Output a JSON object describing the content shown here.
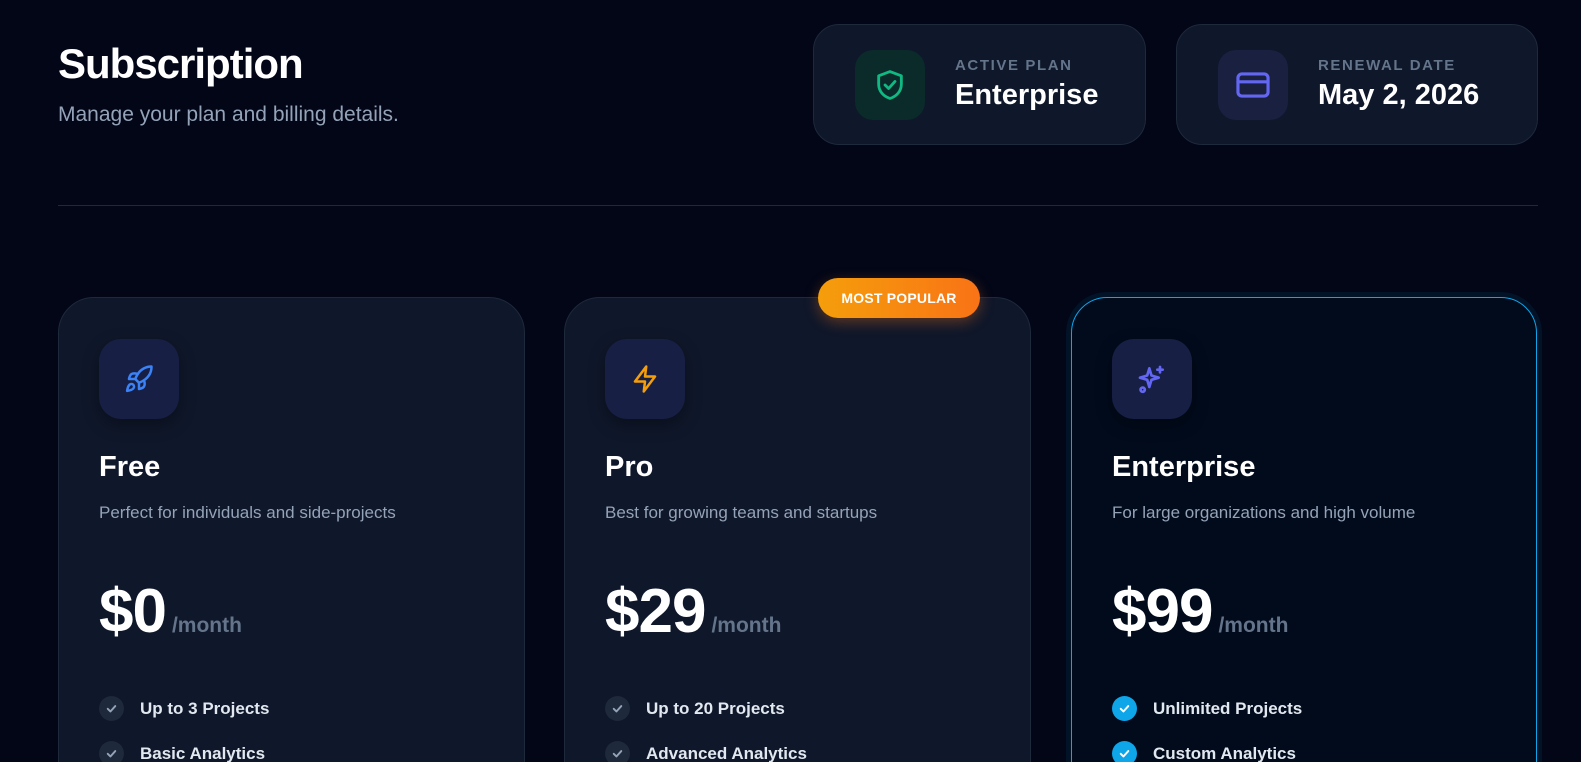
{
  "header": {
    "title": "Subscription",
    "subtitle": "Manage your plan and billing details."
  },
  "stats": {
    "active_plan": {
      "label": "ACTIVE PLAN",
      "value": "Enterprise",
      "icon": "shield-check-icon"
    },
    "renewal": {
      "label": "RENEWAL DATE",
      "value": "May 2, 2026",
      "icon": "credit-card-icon"
    }
  },
  "badge": {
    "label": "MOST POPULAR"
  },
  "plans": [
    {
      "name": "Free",
      "description": "Perfect for individuals and side-projects",
      "price": "$0",
      "period": "/month",
      "icon": "rocket-icon",
      "features": [
        "Up to 3 Projects",
        "Basic Analytics"
      ]
    },
    {
      "name": "Pro",
      "description": "Best for growing teams and startups",
      "price": "$29",
      "period": "/month",
      "icon": "lightning-icon",
      "features": [
        "Up to 20 Projects",
        "Advanced Analytics"
      ]
    },
    {
      "name": "Enterprise",
      "description": "For large organizations and high volume",
      "price": "$99",
      "period": "/month",
      "icon": "sparkles-icon",
      "features": [
        "Unlimited Projects",
        "Custom Analytics"
      ]
    }
  ],
  "colors": {
    "background": "#020617",
    "card": "#0f172a",
    "accent": "#0ea5e9",
    "shield": "#10b981",
    "card_icon": "#6366f1",
    "rocket": "#3b82f6",
    "bolt": "#f59e0b",
    "sparkles": "#6366f1",
    "badge_start": "#f59e0b",
    "badge_end": "#f97316"
  }
}
